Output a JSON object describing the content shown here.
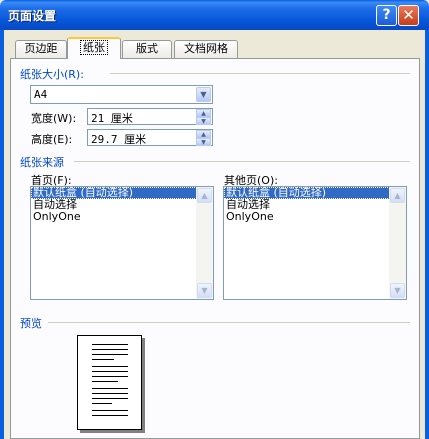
{
  "window": {
    "title": "页面设置",
    "help_glyph": "?",
    "close_glyph": "✕"
  },
  "tabs": [
    {
      "label": "页边距",
      "active": false
    },
    {
      "label": "纸张",
      "active": true
    },
    {
      "label": "版式",
      "active": false
    },
    {
      "label": "文档网格",
      "active": false
    }
  ],
  "paper_size": {
    "group_label": "纸张大小(R):",
    "selected": "A4",
    "width_label": "宽度(W):",
    "width_value": "21 厘米",
    "height_label": "高度(E):",
    "height_value": "29.7 厘米"
  },
  "paper_source": {
    "group_label": "纸张来源",
    "first_page_label": "首页(F):",
    "other_pages_label": "其他页(O):",
    "first_page_items": [
      "默认纸盒 (自动选择)",
      "自动选择",
      "OnlyOne"
    ],
    "other_pages_items": [
      "默认纸盒 (自动选择)",
      "自动选择",
      "OnlyOne"
    ],
    "selected_index": 0
  },
  "preview": {
    "group_label": "预览"
  },
  "colors": {
    "titlebar": "#0A5FE0",
    "selection": "#316AC5",
    "group_label": "#0046D5"
  }
}
